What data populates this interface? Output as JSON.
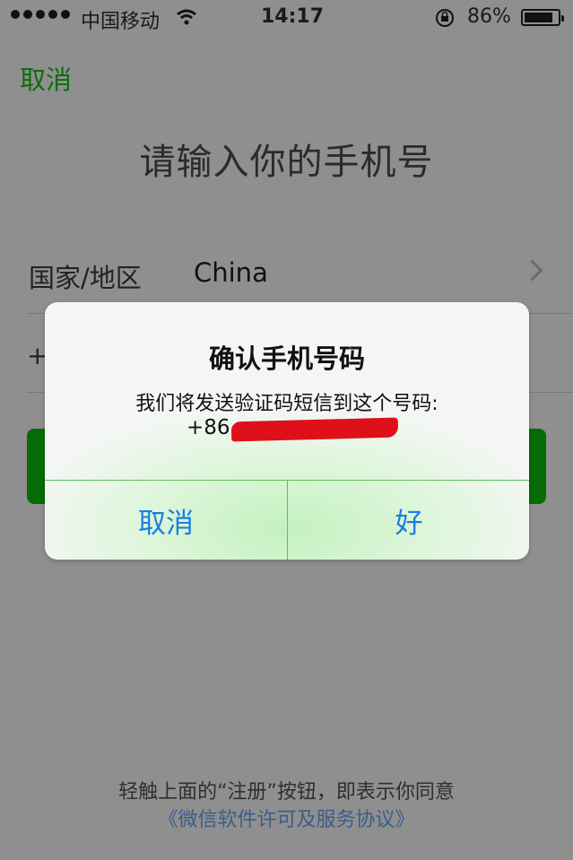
{
  "status_bar": {
    "carrier": "中国移动",
    "time": "14:17",
    "battery_percent": "86%",
    "battery_level": 0.86
  },
  "nav": {
    "cancel_label": "取消"
  },
  "page": {
    "title": "请输入你的手机号"
  },
  "country_row": {
    "label": "国家/地区",
    "value": "China"
  },
  "phone_row": {
    "prefix": "+"
  },
  "alert": {
    "title": "确认手机号码",
    "message": "我们将发送验证码短信到这个号码:",
    "phone_prefix": "+86",
    "cancel_label": "取消",
    "ok_label": "好"
  },
  "footer": {
    "line1": "轻触上面的“注册”按钮，即表示你同意",
    "line2": "《微信软件许可及服务协议》"
  },
  "colors": {
    "accent_green": "#056c05",
    "link_blue": "#1a7fe0",
    "redaction": "#e0101a"
  }
}
